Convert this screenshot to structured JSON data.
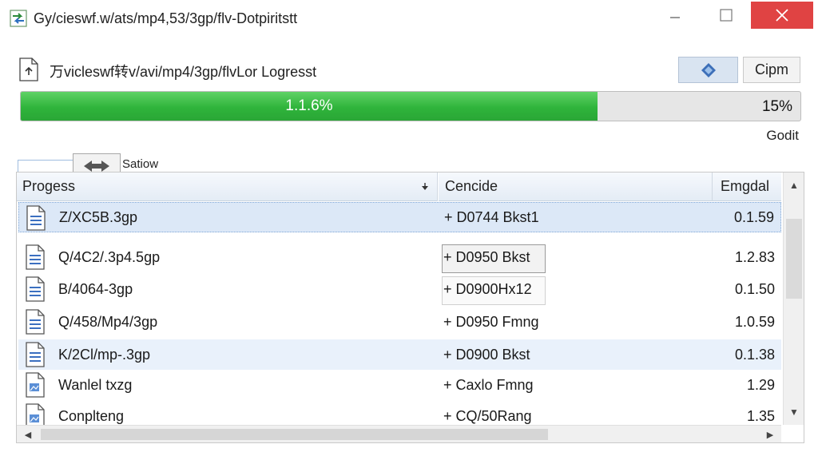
{
  "window": {
    "title": "Gy/cieswf.w/ats/mp4,53/3gp/flv-Dotpiritstt",
    "app_icon": "app-arrows-icon"
  },
  "header": {
    "label": "万viclesw​f转v/avi/mp4/3gp/flvLor Logresst",
    "icon_button": "diamond-icon",
    "text_button": "Cipm"
  },
  "progress": {
    "fill_label": "1.1.6%",
    "percent_label": "15%",
    "fill_fraction": 0.74,
    "status": "Godit",
    "color": "#2fb43b"
  },
  "drag": {
    "label": "Satiow"
  },
  "table": {
    "columns": [
      "Progess",
      "Cencide",
      "Emgdal"
    ],
    "rows": [
      {
        "name": "Z/XC5B.3gp",
        "codec": "+ D0744 Bkst1",
        "value": "0.1.59"
      },
      {
        "name": "Q/4C2/.3p4.5gp",
        "codec": "+ D0950 Bkst",
        "value": "1.2.83"
      },
      {
        "name": "B/4064-3gp",
        "codec": "+ D0900Hx12",
        "value": "0.1.50"
      },
      {
        "name": "Q/458/Mp4/3gp",
        "codec": "+ D0950 Fmng",
        "value": "1.0.59"
      },
      {
        "name": "K/2Cl/mp-.3gp",
        "codec": "+ D0900 Bkst",
        "value": "0.1.38"
      },
      {
        "name": "Wanlel txzg",
        "codec": "+ Caxlo Fmng",
        "value": "1.29"
      },
      {
        "name": "Conplteng",
        "codec": "+ CQ/50Rang",
        "value": "1.35"
      }
    ]
  }
}
